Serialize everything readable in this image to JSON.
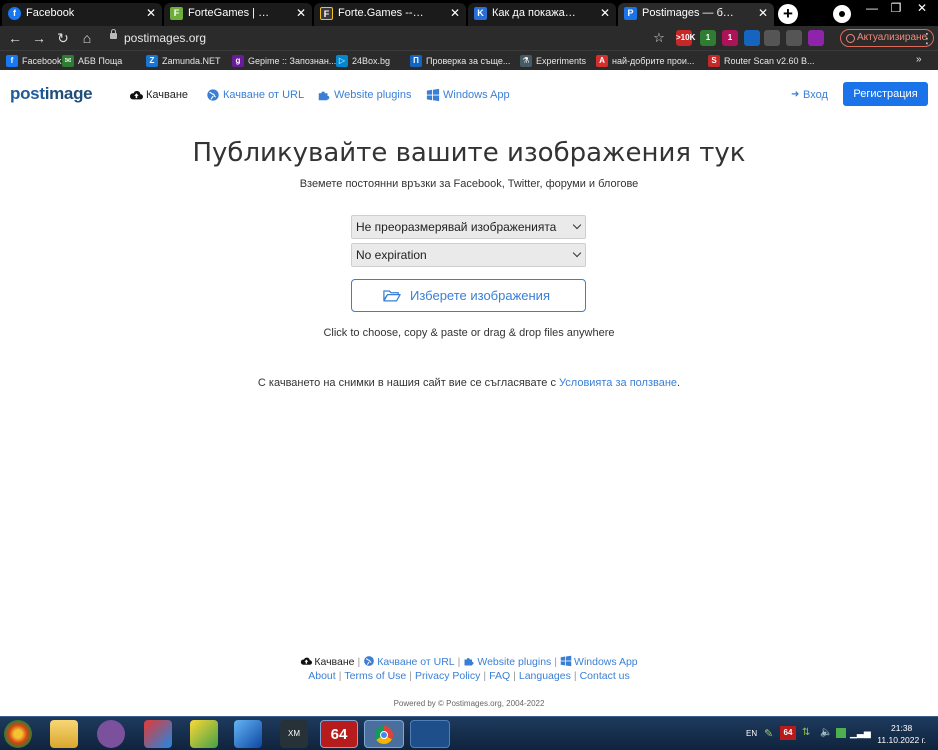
{
  "browser": {
    "tabs": [
      {
        "title": "Facebook",
        "icon": "facebook-icon",
        "color": "#1877f2",
        "glyph": "f"
      },
      {
        "title": "ForteGames | Белот Играй",
        "icon": "fortegames-icon",
        "color": "#6fae3a",
        "glyph": "F"
      },
      {
        "title": "Forte.Games -- Ludo --",
        "icon": "fortegames-icon",
        "color": "#f0c020",
        "glyph": "F"
      },
      {
        "title": "Как да покажа изображен",
        "icon": "k-site-icon",
        "color": "#2a6fd6",
        "glyph": "K"
      },
      {
        "title": "Postimages — безплатен",
        "icon": "postimages-icon",
        "color": "#1a73e8",
        "glyph": "P"
      }
    ],
    "url": "postimages.org",
    "update_label": "Актуализиране",
    "extensions": [
      {
        "name": "extension-10k-icon",
        "label": ">10K",
        "color": "#c62828"
      },
      {
        "name": "extension-tree-icon",
        "label": "1",
        "color": "#2e7d32"
      },
      {
        "name": "extension-badge-icon",
        "label": "1",
        "color": "#ad1457"
      },
      {
        "name": "extension-headset-icon",
        "label": "",
        "color": "#1565c0"
      },
      {
        "name": "extensions-puzzle-icon",
        "label": "",
        "color": "#555555"
      },
      {
        "name": "reading-list-icon",
        "label": "",
        "color": "#555555"
      },
      {
        "name": "profile-icon",
        "label": "",
        "color": "#8e24aa"
      }
    ],
    "bookmarks": [
      {
        "label": "Facebook",
        "color": "#1877f2",
        "glyph": "f"
      },
      {
        "label": "АБВ Поща",
        "color": "#2e7d32",
        "glyph": "✉"
      },
      {
        "label": "Zamunda.NET",
        "color": "#1976d2",
        "glyph": "Z"
      },
      {
        "label": "Gepime :: Запознан...",
        "color": "#6a1b9a",
        "glyph": "g"
      },
      {
        "label": "24Box.bg",
        "color": "#0288d1",
        "glyph": "▷"
      },
      {
        "label": "Проверка за съще...",
        "color": "#1565c0",
        "glyph": "П"
      },
      {
        "label": "Experiments",
        "color": "#455a64",
        "glyph": "⚗"
      },
      {
        "label": "най-добрите прои...",
        "color": "#d32f2f",
        "glyph": "A"
      },
      {
        "label": "Router Scan v2.60 B...",
        "color": "#c62828",
        "glyph": "S"
      }
    ]
  },
  "header": {
    "logo_post": "post",
    "logo_image": "image",
    "nav": [
      {
        "label": "Качване",
        "icon": "cloud-upload-icon"
      },
      {
        "label": "Качване от URL",
        "icon": "globe-icon"
      },
      {
        "label": "Website plugins",
        "icon": "puzzle-icon"
      },
      {
        "label": "Windows App",
        "icon": "windows-icon"
      }
    ],
    "login": "Вход",
    "register": "Регистрация"
  },
  "main": {
    "title": "Публикувайте вашите изображения тук",
    "subtitle": "Вземете постоянни връзки за Facebook, Twitter, форуми и блогове",
    "resize_select": "Не преоразмерявай изображенията",
    "expiration_select": "No expiration",
    "choose_button": "Изберете изображения",
    "hint": "Click to choose, copy & paste or drag & drop files anywhere",
    "terms_prefix": "С качването на снимки в нашия сайт вие се съгласявате с",
    "terms_link": "Условията за ползване",
    "terms_suffix": "."
  },
  "footer": {
    "nav": [
      {
        "label": "Качване"
      },
      {
        "label": "Качване от URL"
      },
      {
        "label": "Website plugins"
      },
      {
        "label": "Windows App"
      }
    ],
    "links": [
      "About",
      "Terms of Use",
      "Privacy Policy",
      "FAQ",
      "Languages",
      "Contact us"
    ],
    "powered": "Powered by © Postimages.org, 2004-2022"
  },
  "taskbar": {
    "apps": [
      "start-orb-icon",
      "file-explorer-icon",
      "viber-icon",
      "ccleaner-icon",
      "puzzle-game-icon",
      "app-icon",
      "xm-play-icon",
      "app-64-icon",
      "chrome-icon",
      "app-blue-icon"
    ],
    "lang": "EN",
    "tray_badge": "64",
    "time": "21:38",
    "date": "11.10.2022 г."
  }
}
